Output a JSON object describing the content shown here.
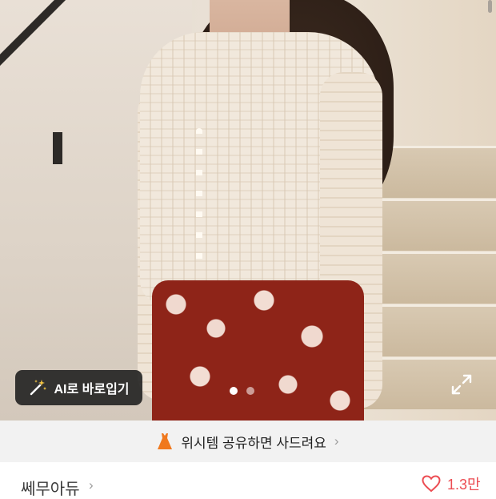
{
  "product_image": {
    "ai_button_label": "AI로 바로입기",
    "carousel": {
      "pages": 2,
      "active_index": 0
    }
  },
  "wishlist_banner": {
    "text": "위시템 공유하면 사드려요",
    "accent_color": "#f0791e"
  },
  "seller": {
    "name": "쎄무아듀"
  },
  "likes": {
    "count": "1.3만",
    "color": "#ec4c52"
  }
}
